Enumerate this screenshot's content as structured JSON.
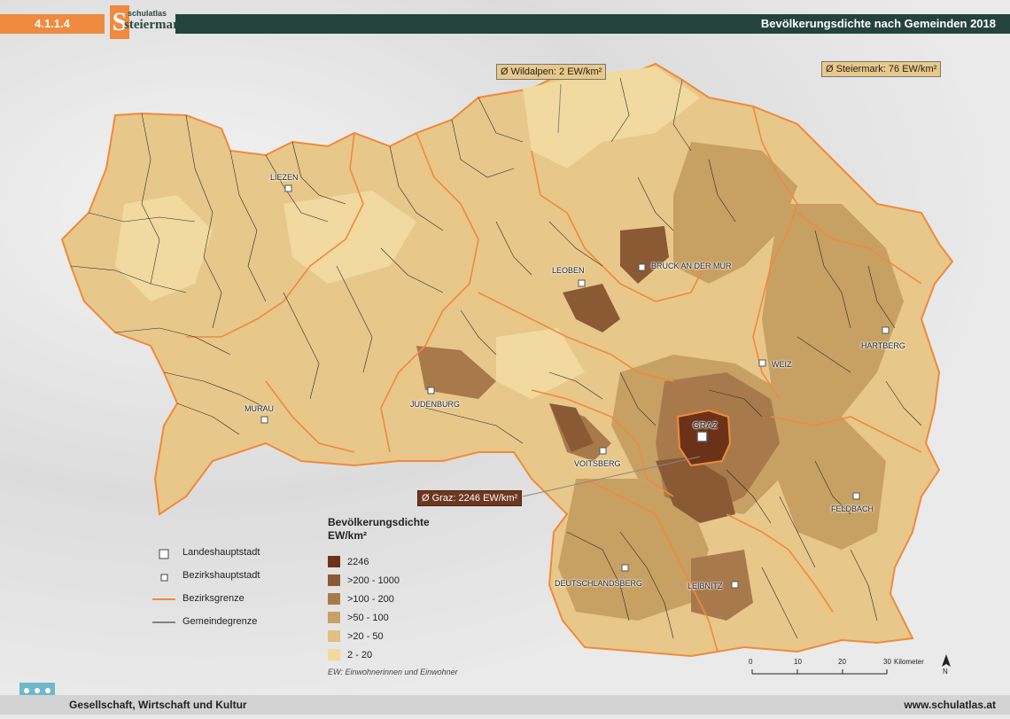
{
  "header": {
    "code": "4.1.1.4",
    "logo_small": "schulatlas",
    "logo_large": "steiermark",
    "logo_letter": "S",
    "title": "Bevölkerungsdichte nach Gemeinden 2018"
  },
  "callouts": {
    "wildalpen": "Ø Wildalpen: 2 EW/km²",
    "steiermark": "Ø Steiermark: 76 EW/km²",
    "graz": "Ø Graz: 2246 EW/km²"
  },
  "cities": {
    "liezen": "LIEZEN",
    "leoben": "LEOBEN",
    "bruck": "BRUCK AN DER MUR",
    "hartberg": "HARTBERG",
    "weiz": "WEIZ",
    "judenburg": "JUDENBURG",
    "murau": "MURAU",
    "graz": "GRAZ",
    "voitsberg": "VOITSBERG",
    "feldbach": "FELDBACH",
    "deutschlandsberg": "DEUTSCHLANDSBERG",
    "leibnitz": "LEIBNITZ"
  },
  "legend": {
    "title_line1": "Bevölkerungsdichte",
    "title_line2": "EW/km²",
    "classes": [
      {
        "label": "2246",
        "color": "#6b3219"
      },
      {
        "label": ">200 - 1000",
        "color": "#8a5a35"
      },
      {
        "label": ">100 - 200",
        "color": "#a87a4b"
      },
      {
        "label": ">50 - 100",
        "color": "#c7a064"
      },
      {
        "label": ">20 - 50",
        "color": "#e0bf7f"
      },
      {
        "label": "2 - 20",
        "color": "#f1d99f"
      }
    ],
    "note": "EW: Einwohnerinnen und Einwohner"
  },
  "symbols": {
    "landeshauptstadt": "Landeshauptstadt",
    "bezirkshauptstadt": "Bezirkshauptstadt",
    "bezirksgrenze": "Bezirksgrenze",
    "gemeindegrenze": "Gemeindegrenze"
  },
  "scale": {
    "ticks": [
      "0",
      "10",
      "20",
      "30"
    ],
    "unit": "Kilometer",
    "north": "N"
  },
  "footer": {
    "left": "Gesellschaft, Wirtschaft und Kultur",
    "right": "www.schulatlas.at"
  },
  "colors": {
    "orange": "#ef8a3e",
    "dark_green": "#24443b",
    "district_border": "#f08a3c"
  }
}
